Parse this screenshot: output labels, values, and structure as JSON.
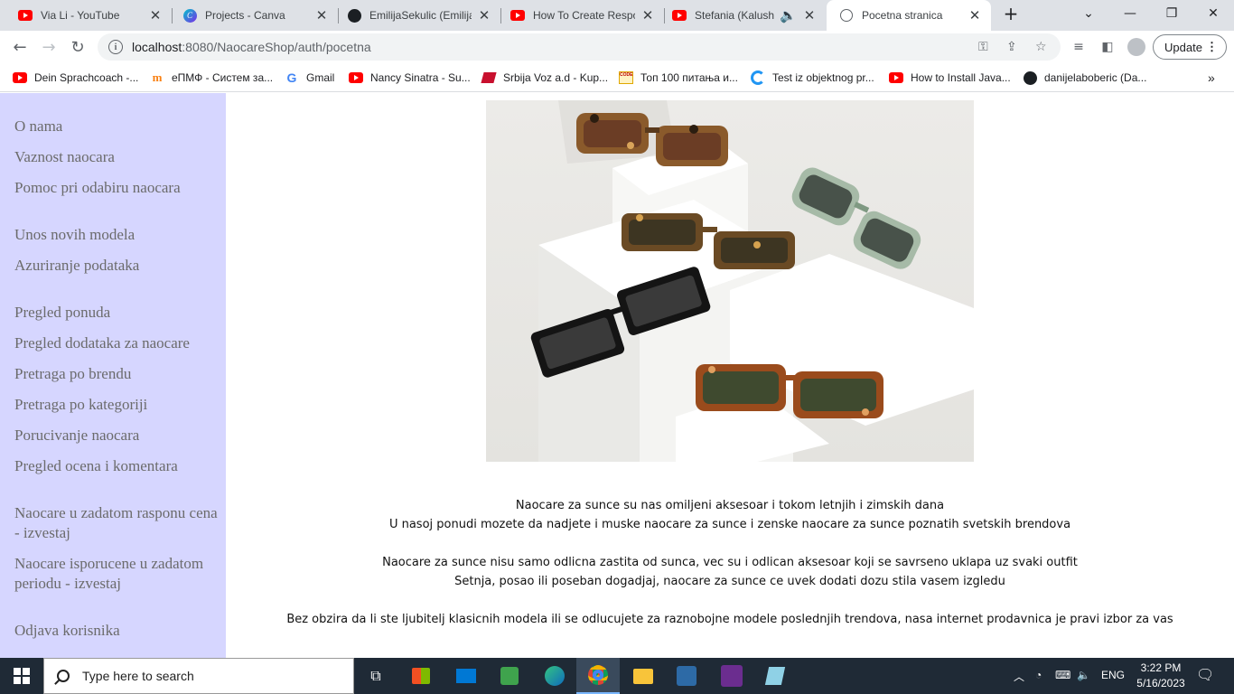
{
  "browser": {
    "tabs": [
      {
        "title": "Via Li - YouTube",
        "icon": "youtube-icon",
        "active": false
      },
      {
        "title": "Projects - Canva",
        "icon": "canva-icon",
        "active": false
      },
      {
        "title": "EmilijaSekulic (Emilija",
        "icon": "github-icon",
        "active": false
      },
      {
        "title": "How To Create Respo",
        "icon": "youtube-icon",
        "active": false
      },
      {
        "title": "Stefania (Kalush C",
        "icon": "youtube-icon",
        "active": false
      },
      {
        "title": "Pocetna stranica",
        "icon": "globe-icon",
        "active": true
      }
    ],
    "new_tab": "+",
    "url_host": "localhost",
    "url_rest": ":8080/NaocareShop/auth/pocetna",
    "update_label": "Update",
    "bookmarks": [
      {
        "label": "Dein Sprachcoach -...",
        "icon": "youtube-icon"
      },
      {
        "label": "еПМФ - Систем за...",
        "icon": "moodle-icon"
      },
      {
        "label": "Gmail",
        "icon": "google-icon"
      },
      {
        "label": "Nancy Sinatra - Su...",
        "icon": "youtube-icon"
      },
      {
        "label": "Srbija Voz a.d - Kup...",
        "icon": "srbijavoz-icon"
      },
      {
        "label": "Топ 100 питања и...",
        "icon": "code-icon"
      },
      {
        "label": "Test iz objektnog pr...",
        "icon": "moz-icon"
      },
      {
        "label": "How to Install Java...",
        "icon": "youtube-icon"
      },
      {
        "label": "danijelaboberic (Da...",
        "icon": "github-icon"
      }
    ],
    "bookmarks_more": "»"
  },
  "sidebar": {
    "groups": [
      {
        "items": [
          "O nama",
          "Vaznost naocara",
          "Pomoc pri odabiru naocara"
        ]
      },
      {
        "items": [
          "Unos novih modela",
          "Azuriranje podataka"
        ]
      },
      {
        "items": [
          "Pregled ponuda",
          "Pregled dodataka za naocare",
          "Pretraga po brendu",
          "Pretraga po kategoriji",
          "Porucivanje naocara",
          "Pregled ocena i komentara"
        ]
      },
      {
        "items": [
          "Naocare u zadatom rasponu cena - izvestaj",
          "Naocare isporucene u zadatom periodu - izvestaj"
        ]
      },
      {
        "items": [
          "Odjava korisnika"
        ]
      }
    ]
  },
  "main": {
    "hero_image": "sunglasses-photo",
    "paragraphs": [
      [
        "Naocare za sunce su nas omiljeni aksesoar i tokom letnjih i zimskih dana",
        "U nasoj ponudi mozete da nadjete i muske naocare za sunce i zenske naocare za sunce poznatih svetskih brendova"
      ],
      [
        "Naocare za sunce nisu samo odlicna zastita od sunca, vec su i odlican aksesoar koji se savrseno uklapa uz svaki outfit",
        "Setnja, posao ili poseban dogadjaj, naocare za sunce ce uvek dodati dozu stila vasem izgledu"
      ],
      [
        "Bez obzira da li ste ljubitelj klasicnih modela ili se odlucujete za raznobojne modele poslednjih trendova, nasa internet prodavnica je pravi izbor za vas"
      ]
    ]
  },
  "taskbar": {
    "search_placeholder": "Type here to search",
    "language": "ENG",
    "time": "3:22 PM",
    "date": "5/16/2023"
  }
}
